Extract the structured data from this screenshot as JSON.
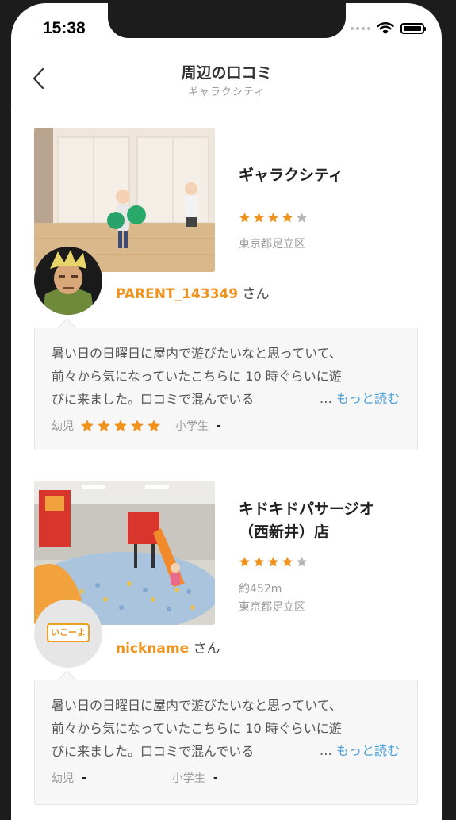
{
  "status_bar": {
    "time": "15:38"
  },
  "nav": {
    "title": "周辺の口コミ",
    "subtitle": "ギャラクシティ"
  },
  "reviews": [
    {
      "shop_name_lines": [
        "ギャラクシティ"
      ],
      "rating": 4,
      "distance": "",
      "address": "東京都足立区",
      "nickname": "PARENT_143349",
      "honorific": " さん",
      "review_lines": [
        "暑い日の日曜日に屋内で遊びたいなと思っていて、",
        "前々から気になっていたこちらに 10 時ぐらいに遊",
        "びに来ました。口コミで混んでいる"
      ],
      "more_prefix": "… ",
      "more_label": "もっと読む",
      "age_infant_label": "幼児",
      "age_infant_rating": 5,
      "age_school_label": "小学生",
      "age_school_value": "-"
    },
    {
      "shop_name_lines": [
        "キドキドパサージオ",
        "（西新井）店"
      ],
      "rating": 4,
      "distance": "約452m",
      "address": "東京都足立区",
      "nickname": "nickname",
      "honorific": " さん",
      "review_lines": [
        "暑い日の日曜日に屋内で遊びたいなと思っていて、",
        "前々から気になっていたこちらに 10 時ぐらいに遊",
        "びに来ました。口コミで混んでいる"
      ],
      "more_prefix": "… ",
      "more_label": "もっと読む",
      "age_infant_label": "幼児",
      "age_infant_value": "-",
      "age_school_label": "小学生",
      "age_school_value": "-"
    }
  ],
  "logo_text": "いこーよ",
  "colors": {
    "star_active": "#f0921e",
    "star_inactive": "#b5b5b5",
    "link": "#4a9fd8",
    "nickname": "#f0921e"
  },
  "icons": [
    "back-chevron-icon",
    "wifi-icon",
    "battery-icon",
    "star-icon"
  ]
}
